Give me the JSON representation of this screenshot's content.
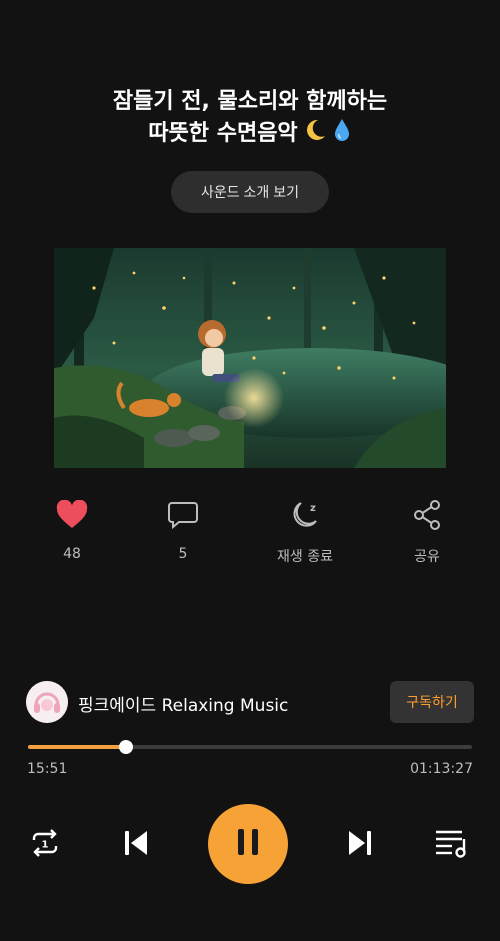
{
  "track": {
    "title_line1": "잠들기 전, 물소리와 함께하는",
    "title_line2": "따뜻한 수면음악"
  },
  "intro_button_label": "사운드 소개 보기",
  "actions": [
    {
      "name": "like",
      "icon": "heart-icon",
      "label": "48",
      "color": "#ee4d5d"
    },
    {
      "name": "comments",
      "icon": "comment-icon",
      "label": "5"
    },
    {
      "name": "sleep-timer",
      "icon": "moon-zzz-icon",
      "label": "재생 종료"
    },
    {
      "name": "share",
      "icon": "share-icon",
      "label": "공유"
    }
  ],
  "channel": {
    "name": "핑크에이드 Relaxing Music",
    "subscribe_label": "구독하기"
  },
  "playback": {
    "elapsed": "15:51",
    "duration": "01:13:27",
    "progress_fraction": 0.22
  },
  "controls": [
    {
      "name": "repeat-one",
      "icon": "repeat-one-icon"
    },
    {
      "name": "previous",
      "icon": "previous-icon"
    },
    {
      "name": "pause",
      "icon": "pause-icon"
    },
    {
      "name": "next",
      "icon": "next-icon"
    },
    {
      "name": "playlist",
      "icon": "playlist-icon"
    }
  ],
  "colors": {
    "accent": "#f7a236",
    "background": "#121212",
    "like": "#ee4d5d"
  }
}
